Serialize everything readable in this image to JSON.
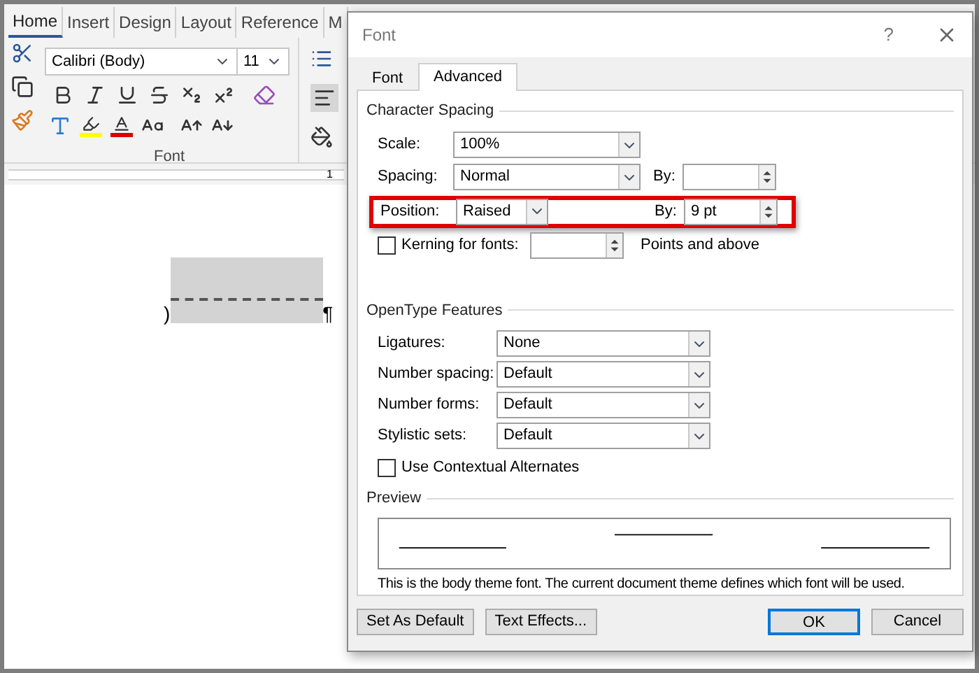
{
  "ribbon": {
    "tabs": [
      {
        "label": "Home",
        "selected": true
      },
      {
        "label": "Insert",
        "selected": false
      },
      {
        "label": "Design",
        "selected": false
      },
      {
        "label": "Layout",
        "selected": false
      },
      {
        "label": "Reference",
        "selected": false
      },
      {
        "label": "M",
        "selected": false
      }
    ],
    "font_name": "Calibri (Body)",
    "font_size": "11",
    "group_label": "Font",
    "ruler_mark": "1"
  },
  "document": {
    "before": ")",
    "pilcrow": "¶"
  },
  "dialog": {
    "title": "Font",
    "help": "?",
    "tabs": [
      {
        "label": "Font",
        "selected": false
      },
      {
        "label": "Advanced",
        "selected": true
      }
    ],
    "character_spacing": {
      "heading": "Character Spacing",
      "rows": [
        {
          "label": "Scale:",
          "value": "100%",
          "highlighted": false
        },
        {
          "label": "Spacing:",
          "value": "Normal",
          "by_label": "By:",
          "highlighted": false
        },
        {
          "label": "Position:",
          "value": "Raised",
          "by_label": "By:",
          "by_value": "9 pt",
          "highlighted": true
        }
      ],
      "kerning": {
        "label": "Kerning for fonts:",
        "checked": false,
        "suffix": "Points and above"
      }
    },
    "opentype": {
      "heading": "OpenType Features",
      "rows": [
        {
          "label": "Ligatures:",
          "value": "None"
        },
        {
          "label": "Number spacing:",
          "value": "Default"
        },
        {
          "label": "Number forms:",
          "value": "Default"
        },
        {
          "label": "Stylistic sets:",
          "value": "Default"
        }
      ],
      "contextual": {
        "label": "Use Contextual Alternates",
        "checked": false
      }
    },
    "preview": {
      "heading": "Preview",
      "description": "This is the body theme font. The current document theme defines which font will be used."
    },
    "buttons": [
      {
        "label": "Set As Default",
        "default": false
      },
      {
        "label": "Text Effects...",
        "default": false
      },
      {
        "label": "OK",
        "default": true
      },
      {
        "label": "Cancel",
        "default": false
      }
    ]
  }
}
